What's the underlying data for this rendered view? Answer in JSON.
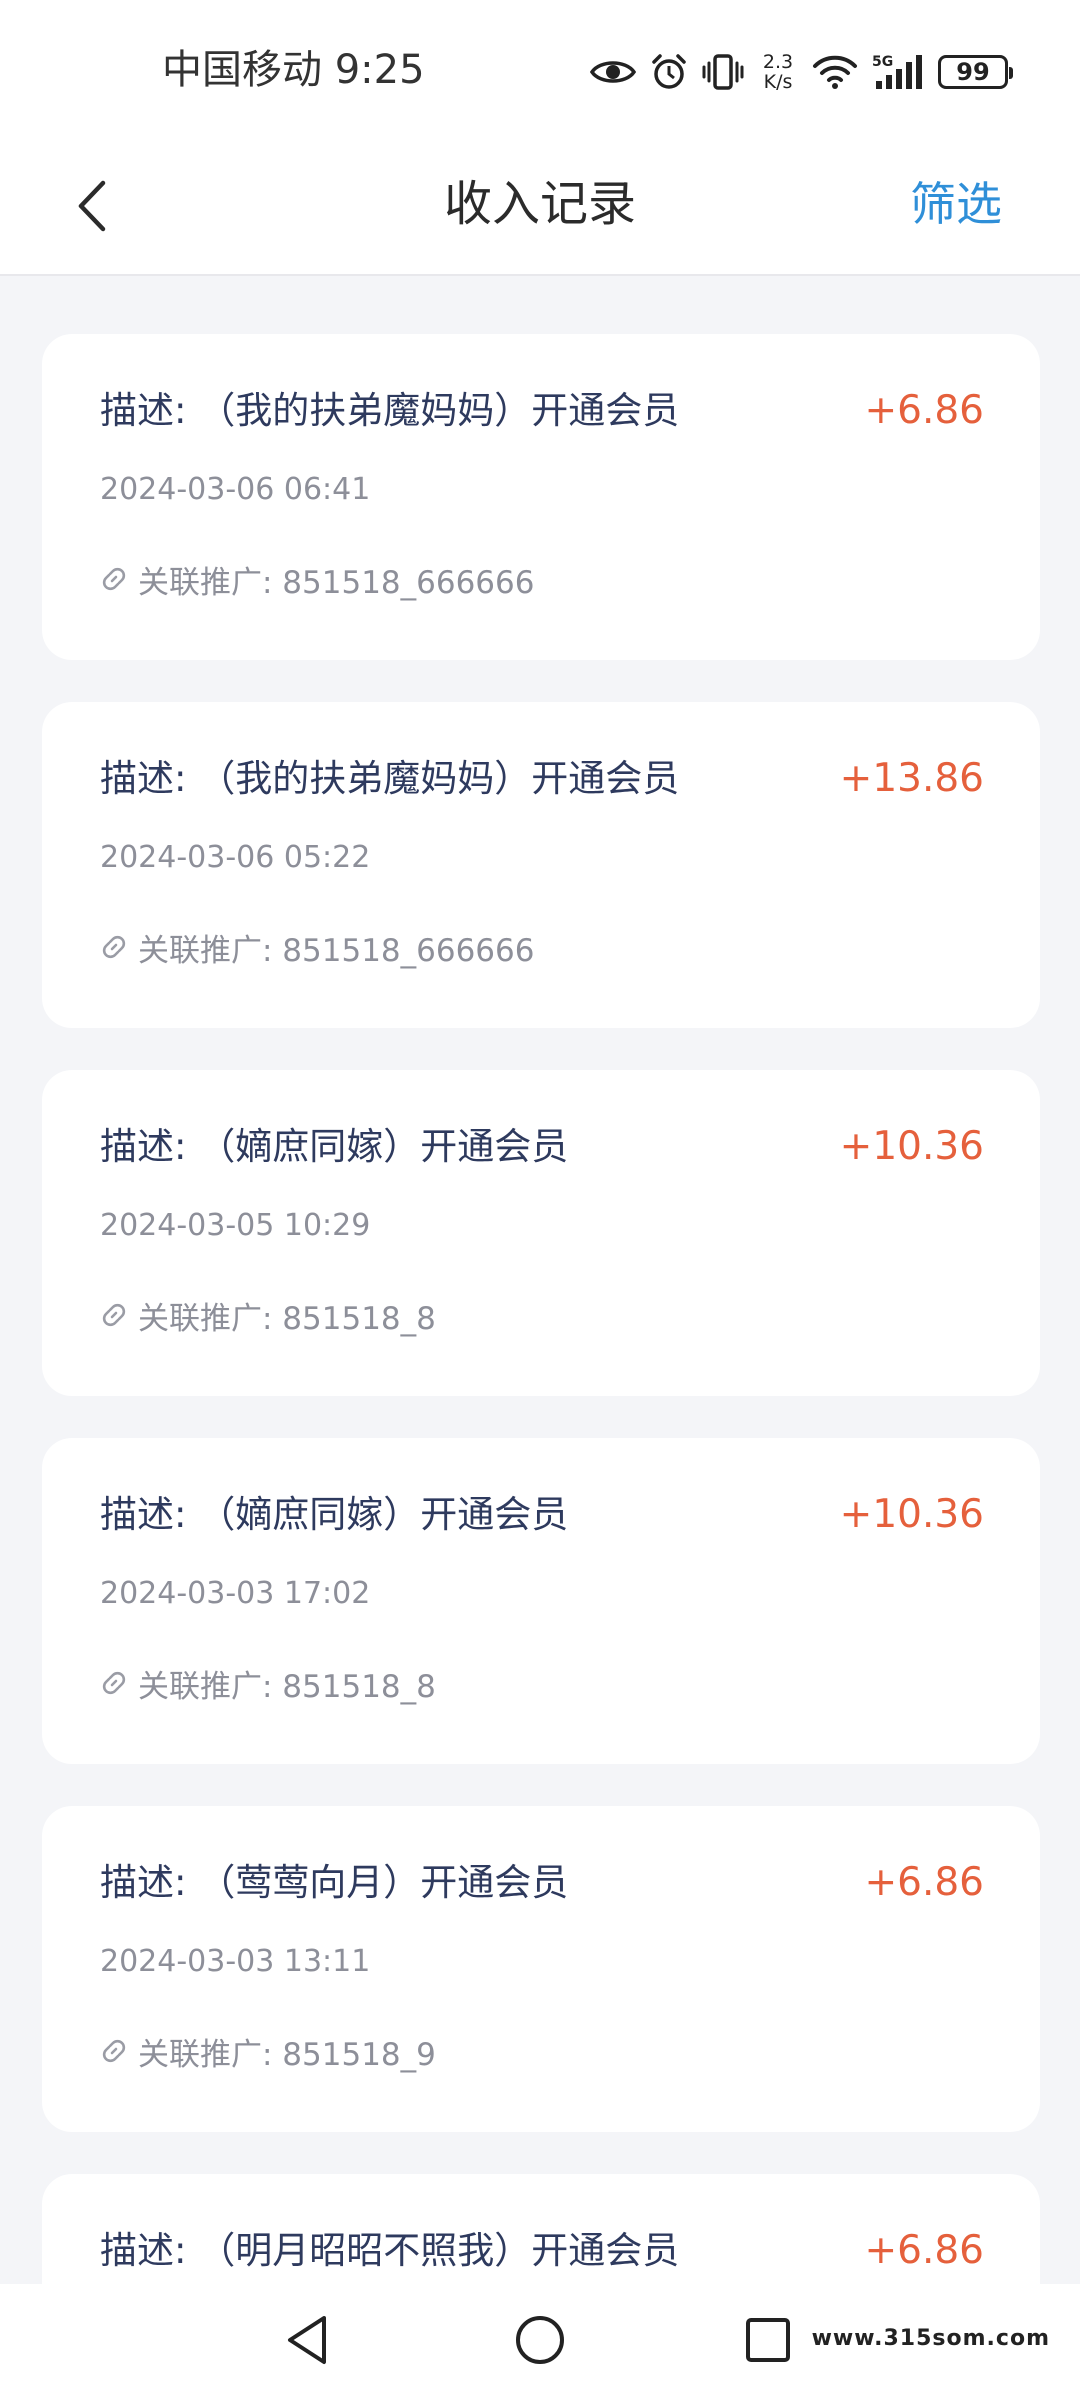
{
  "status_bar": {
    "carrier_time": "中国移动 9:25",
    "net_speed_value": "2.3",
    "net_speed_unit": "K/s",
    "battery": "99"
  },
  "nav": {
    "title": "收入记录",
    "filter_label": "筛选"
  },
  "records": [
    {
      "description": "描述: （我的扶弟魔妈妈）开通会员",
      "amount": "+6.86",
      "time": "2024-03-06 06:41",
      "link": "关联推广: 851518_666666"
    },
    {
      "description": "描述: （我的扶弟魔妈妈）开通会员",
      "amount": "+13.86",
      "time": "2024-03-06 05:22",
      "link": "关联推广: 851518_666666"
    },
    {
      "description": "描述: （嫡庶同嫁）开通会员",
      "amount": "+10.36",
      "time": "2024-03-05 10:29",
      "link": "关联推广: 851518_8"
    },
    {
      "description": "描述: （嫡庶同嫁）开通会员",
      "amount": "+10.36",
      "time": "2024-03-03 17:02",
      "link": "关联推广: 851518_8"
    },
    {
      "description": "描述: （莺莺向月）开通会员",
      "amount": "+6.86",
      "time": "2024-03-03 13:11",
      "link": "关联推广: 851518_9"
    },
    {
      "description": "描述: （明月昭昭不照我）开通会员",
      "amount": "+6.86",
      "time": "",
      "link": ""
    }
  ],
  "watermark": "www.315som.com",
  "colors": {
    "accent_blue": "#2f8fd8",
    "amount_red": "#e5603c",
    "page_bg": "#f4f5f8",
    "desc_text": "#2e3a5e",
    "meta_text": "#8d8f99"
  },
  "icons": {
    "back": "chevron-left-icon",
    "link": "link-icon",
    "eye": "eye-icon",
    "alarm": "alarm-icon",
    "vibrate": "vibrate-icon",
    "wifi": "wifi-icon",
    "signal": "signal-5g-icon",
    "nav_back": "triangle-back-icon",
    "nav_home": "circle-home-icon",
    "nav_recents": "square-recents-icon"
  }
}
